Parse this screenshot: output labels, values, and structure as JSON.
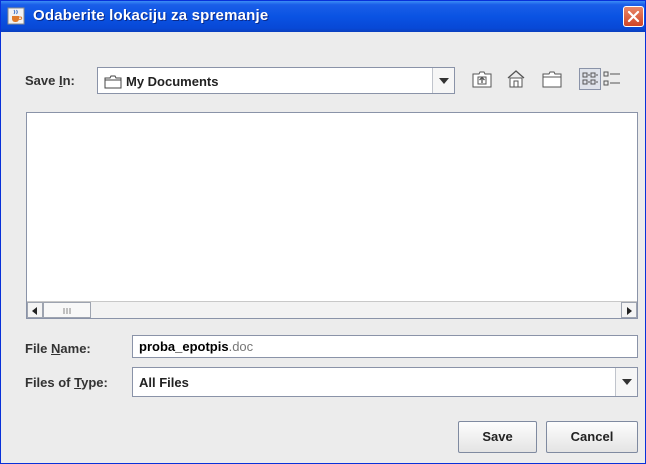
{
  "window": {
    "title": "Odaberite lokaciju za spremanje",
    "icon": "java-cup-icon",
    "close_icon": "close-icon"
  },
  "save_in": {
    "label_pre": "Save ",
    "label_mnemonic": "I",
    "label_post": "n:",
    "value": "My Documents",
    "value_icon": "folder-icon"
  },
  "toolbar": {
    "buttons": [
      "up-one-level-icon",
      "home-icon",
      "new-folder-icon",
      "list-view-icon",
      "details-view-icon"
    ]
  },
  "file_list": {
    "items": [],
    "scrollbar": {
      "left_arrow": "◀",
      "right_arrow": "▶"
    }
  },
  "file_name": {
    "label_pre": "File ",
    "label_mnemonic": "N",
    "label_post": "ame:",
    "value_main": "proba_epotpis",
    "value_ext": ".doc"
  },
  "file_type": {
    "label_pre": "Files of ",
    "label_mnemonic": "T",
    "label_post": "ype:",
    "value": "All Files"
  },
  "buttons": {
    "save": "Save",
    "cancel": "Cancel"
  },
  "colors": {
    "titlebar": "#0a53e3",
    "close": "#d04527",
    "dialog_bg": "#ececec"
  }
}
